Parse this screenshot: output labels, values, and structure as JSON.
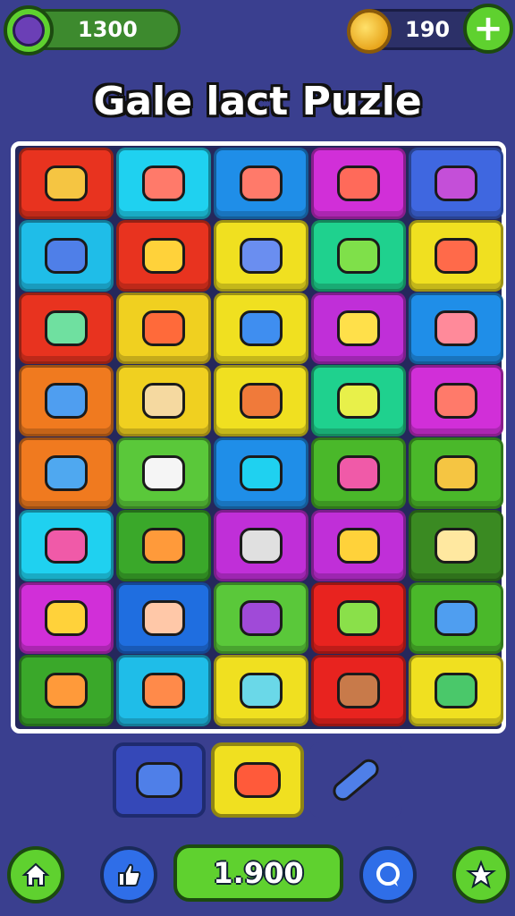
{
  "header": {
    "gems": "1300",
    "coins": "190",
    "add_label": "+"
  },
  "title": "Gale lact Puzle",
  "board": {
    "rows": [
      [
        {
          "color": "#e8331f",
          "icon": "candy-icon"
        },
        {
          "color": "#1fd1f0",
          "icon": "heart-icon"
        },
        {
          "color": "#1f8ee8",
          "icon": "heart-icon"
        },
        {
          "color": "#d12fd8",
          "icon": "apple-icon"
        },
        {
          "color": "#3f67e0",
          "icon": "bag-icon"
        }
      ],
      [
        {
          "color": "#1fbde8",
          "icon": "pen-icon"
        },
        {
          "color": "#e8331f",
          "icon": "monster-icon"
        },
        {
          "color": "#f0e020",
          "icon": "ticket-icon"
        },
        {
          "color": "#1fd18e",
          "icon": "frog-icon"
        },
        {
          "color": "#f0e020",
          "icon": "key-icon"
        }
      ],
      [
        {
          "color": "#e8331f",
          "icon": "blob-icon"
        },
        {
          "color": "#f0d020",
          "icon": "sun-icon"
        },
        {
          "color": "#f0e020",
          "icon": "tube-icon"
        },
        {
          "color": "#c02fd8",
          "icon": "star-wand-icon"
        },
        {
          "color": "#1f8ee8",
          "icon": "pencil-icon"
        }
      ],
      [
        {
          "color": "#f07a1f",
          "icon": "fish-icon"
        },
        {
          "color": "#f0d020",
          "icon": "bear-icon"
        },
        {
          "color": "#f0e020",
          "icon": "pinecone-icon"
        },
        {
          "color": "#1fd18e",
          "icon": "lemon-icon"
        },
        {
          "color": "#d12fd8",
          "icon": "heart-icon"
        }
      ],
      [
        {
          "color": "#f07a1f",
          "icon": "leaf-icon"
        },
        {
          "color": "#5ac83a",
          "icon": "magnifier-icon"
        },
        {
          "color": "#1f8ee8",
          "icon": "ring-icon"
        },
        {
          "color": "#4ab82a",
          "icon": "popsicle-icon"
        },
        {
          "color": "#4ab82a",
          "icon": "candy-icon"
        }
      ],
      [
        {
          "color": "#1fd1f0",
          "icon": "popsicle-icon"
        },
        {
          "color": "#3aa82a",
          "icon": "carrot-icon"
        },
        {
          "color": "#c02fd8",
          "icon": "jar-icon"
        },
        {
          "color": "#c02fd8",
          "icon": "keyhole-icon"
        },
        {
          "color": "#3a8a22",
          "icon": "star-icon"
        }
      ],
      [
        {
          "color": "#d12fd8",
          "icon": "lollipop-icon"
        },
        {
          "color": "#1f6ee0",
          "icon": "virus-icon"
        },
        {
          "color": "#5ac83a",
          "icon": "brush-icon"
        },
        {
          "color": "#e8231f",
          "icon": "ruler-icon"
        },
        {
          "color": "#4ab82a",
          "icon": "fish-icon"
        }
      ],
      [
        {
          "color": "#3aa82a",
          "icon": "carrot-icon"
        },
        {
          "color": "#1fbde8",
          "icon": "bell-icon"
        },
        {
          "color": "#f0e020",
          "icon": "map-icon"
        },
        {
          "color": "#e8231f",
          "icon": "face-icon"
        },
        {
          "color": "#f0e020",
          "icon": "turtle-icon"
        }
      ]
    ]
  },
  "tray": [
    {
      "color": "#3548b8",
      "icon": "pen-icon"
    },
    {
      "color": "#f0e020",
      "icon": "match-icon"
    },
    {
      "color": "#3a3f8f",
      "icon": "marker-icon"
    }
  ],
  "footer": {
    "score": "1.900"
  },
  "icon_colors": {
    "candy-icon": "#f5c542",
    "heart-icon": "#ff7a6a",
    "apple-icon": "#ff6a5a",
    "bag-icon": "#c44fd8",
    "pen-icon": "#4f7fe8",
    "monster-icon": "#ffd23a",
    "ticket-icon": "#6a8ef0",
    "frog-icon": "#7fe04a",
    "key-icon": "#ff6a4a",
    "blob-icon": "#6fe0a0",
    "sun-icon": "#ff6a3a",
    "tube-icon": "#3f8ef0",
    "star-wand-icon": "#ffe04a",
    "pencil-icon": "#ff8a9a",
    "fish-icon": "#4f9ef0",
    "bear-icon": "#f5d9a0",
    "pinecone-icon": "#f07a3a",
    "lemon-icon": "#e8f04a",
    "leaf-icon": "#4fa8f0",
    "magnifier-icon": "#f5f5f5",
    "ring-icon": "#1fd1f0",
    "popsicle-icon": "#f05aa8",
    "carrot-icon": "#ff9a3a",
    "jar-icon": "#e0e0e0",
    "keyhole-icon": "#ffd23a",
    "star-icon": "#ffe8a0",
    "lollipop-icon": "#ffd23a",
    "virus-icon": "#ffc8a8",
    "brush-icon": "#a04ad8",
    "ruler-icon": "#8ae04a",
    "bell-icon": "#ff8a4a",
    "map-icon": "#6ad8e8",
    "face-icon": "#c87a4a",
    "turtle-icon": "#4ac86a",
    "match-icon": "#ff5a3a",
    "marker-icon": "#4f7fe8"
  }
}
